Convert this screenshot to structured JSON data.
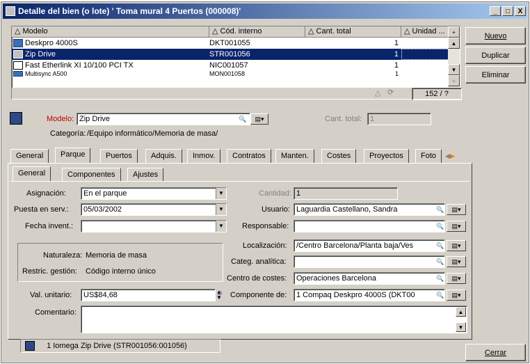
{
  "window": {
    "title": "Detalle del bien (o lote) ' Toma mural 4 Puertos (000008)'",
    "controls": [
      "_",
      "□",
      "X"
    ]
  },
  "list": {
    "columns": [
      "Modelo",
      "Cód. interno",
      "Cant. total",
      "Unidad ..."
    ],
    "rows": [
      {
        "modelo": "Deskpro 4000S",
        "codigo": "DKT001055",
        "cant": "1",
        "unidad": ""
      },
      {
        "modelo": "Zip Drive",
        "codigo": "STR001056",
        "cant": "1",
        "unidad": ""
      },
      {
        "modelo": "Fast Etherlink XI 10/100 PCI TX",
        "codigo": "NIC001057",
        "cant": "1",
        "unidad": ""
      },
      {
        "modelo": "Multisync A500",
        "codigo": "MON001058",
        "cant": "1",
        "unidad": ""
      }
    ],
    "selected_index": 1,
    "counter": "152 / ?",
    "add_symbol": "+"
  },
  "side_buttons": {
    "nuevo": "Nuevo",
    "duplicar": "Duplicar",
    "eliminar": "Eliminar",
    "cerrar": "Cerrar"
  },
  "header_form": {
    "modelo_label": "Modelo:",
    "modelo_value": "Zip Drive",
    "cant_total_label": "Cant. total:",
    "cant_total_value": "1",
    "categoria_label": "Categoría:",
    "categoria_value": "/Equipo informático/Memoria de masa/"
  },
  "main_tabs": [
    "General",
    "Parque",
    "Puertos",
    "Adquis.",
    "Inmov.",
    "Contratos",
    "Manten.",
    "Costes",
    "Proyectos",
    "Foto"
  ],
  "main_tab_active": "Parque",
  "sub_tabs": [
    "General",
    "Componentes",
    "Ajustes"
  ],
  "sub_tab_active": "General",
  "parque": {
    "asignacion_label": "Asignación:",
    "asignacion_value": "En el parque",
    "puesta_label": "Puesta en serv.:",
    "puesta_value": "05/03/2002",
    "fecha_label": "Fecha invent.:",
    "fecha_value": "",
    "naturaleza_label": "Naturaleza:",
    "naturaleza_value": "Memoria de masa",
    "restric_label": "Restric. gestión:",
    "restric_value": "Código interno único",
    "val_label": "Val. unitario:",
    "val_value": "US$84,68",
    "comentario_label": "Comentario:",
    "comentario_value": "",
    "cantidad_label": "Cantidad:",
    "cantidad_value": "1",
    "usuario_label": "Usuario:",
    "usuario_value": "Laguardia Castellano, Sandra",
    "responsable_label": "Responsable:",
    "responsable_value": "",
    "localizacion_label": "Localización:",
    "localizacion_value": "/Centro Barcelona/Planta baja/Ves",
    "categ_label": "Categ. analítica:",
    "categ_value": "",
    "centro_label": "Centro de costes:",
    "centro_value": "Operaciones Barcelona",
    "componente_label": "Componente de:",
    "componente_value": "1 Compaq Deskpro 4000S (DKT00"
  },
  "status_bar": {
    "text": "1 Iomega Zip Drive (STR001056:001056)"
  },
  "colors": {
    "title_start": "#0a246a",
    "title_end": "#a6caf0",
    "selection": "#0a246a",
    "modelo_label": "#c00000"
  }
}
